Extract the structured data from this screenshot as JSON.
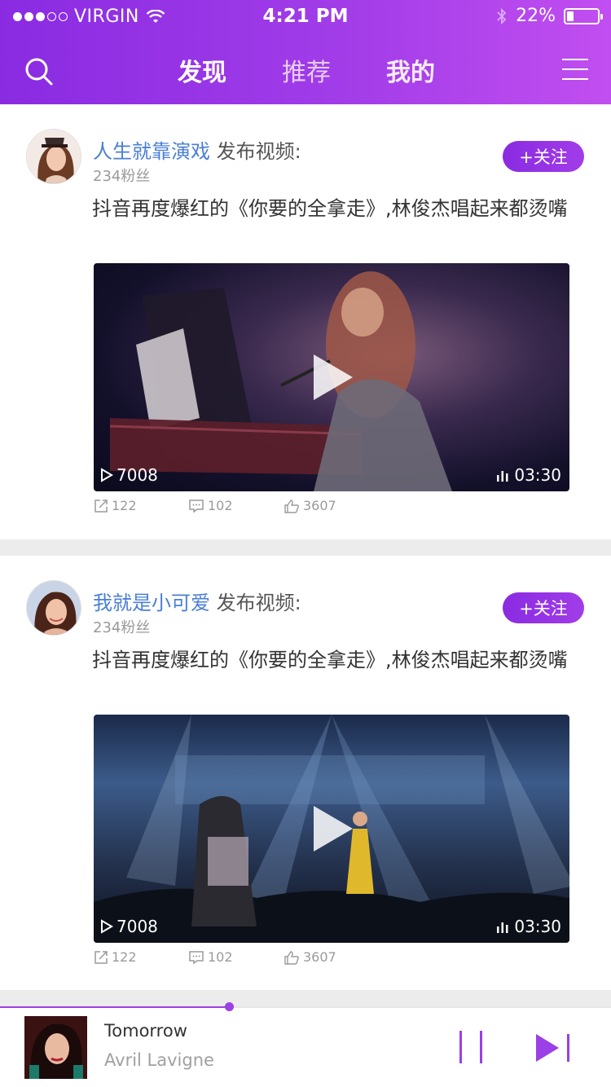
{
  "status_bar": {
    "carrier": "VIRGIN",
    "time": "4:21 PM",
    "battery": "22%"
  },
  "nav": {
    "tabs": [
      {
        "label": "发现",
        "active": true
      },
      {
        "label": "推荐",
        "active": false
      },
      {
        "label": "我的",
        "active": false
      }
    ]
  },
  "feed": [
    {
      "author": "人生就靠演戏",
      "action": "发布视频:",
      "fans": "234粉丝",
      "follow_label": "+关注",
      "title": "抖音再度爆红的《你要的全拿走》,林俊杰唱起来都烫嘴",
      "plays": "7008",
      "duration": "03:30",
      "shares": "122",
      "comments": "102",
      "likes": "3607"
    },
    {
      "author": "我就是小可爱",
      "action": "发布视频:",
      "fans": "234粉丝",
      "follow_label": "+关注",
      "title": "抖音再度爆红的《你要的全拿走》,林俊杰唱起来都烫嘴",
      "plays": "7008",
      "duration": "03:30",
      "shares": "122",
      "comments": "102",
      "likes": "3607"
    }
  ],
  "player": {
    "song": "Tomorrow",
    "artist": "Avril Lavigne",
    "progress": 0.375
  },
  "colors": {
    "accent": "#9b3fe6",
    "author_link": "#4a7fd6"
  }
}
